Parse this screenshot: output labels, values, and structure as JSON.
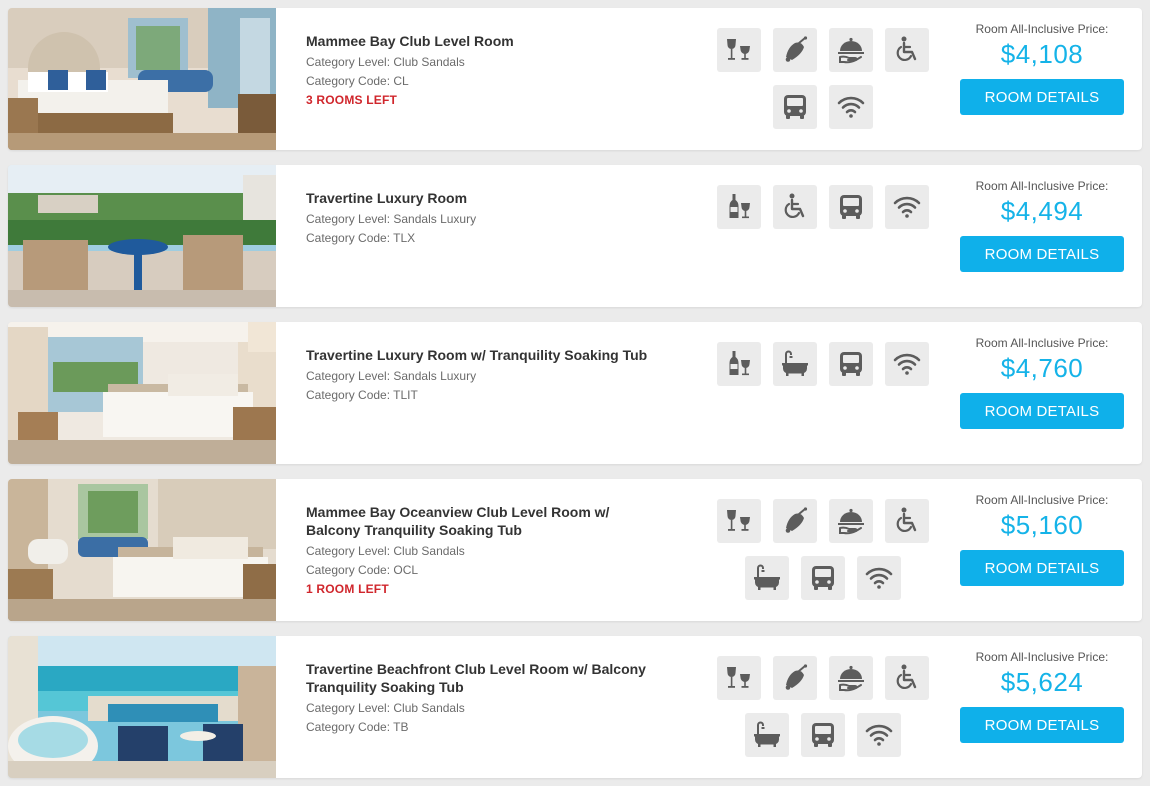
{
  "price_label": "Room All-Inclusive Price:",
  "button_label": "ROOM DETAILS",
  "colors": {
    "accent": "#0fb0ea",
    "alert": "#d0262c",
    "icon": "#5c5c5c",
    "icon_bg": "#ebebeb"
  },
  "rooms": [
    {
      "name": "Mammee Bay Club Level Room",
      "category_level": "Category Level: Club Sandals",
      "category_code": "Category Code: CL",
      "rooms_left": "3 ROOMS LEFT",
      "price": "$4,108",
      "amenities": [
        [
          "wine-glasses-icon",
          "bell-icon",
          "room-service-icon",
          "accessible-icon"
        ],
        [
          "shuttle-bus-icon",
          "wifi-icon"
        ]
      ]
    },
    {
      "name": "Travertine Luxury Room",
      "category_level": "Category Level: Sandals Luxury",
      "category_code": "Category Code: TLX",
      "rooms_left": "",
      "price": "$4,494",
      "amenities": [
        [
          "wine-bottle-icon",
          "accessible-icon",
          "shuttle-bus-icon",
          "wifi-icon"
        ]
      ]
    },
    {
      "name": "Travertine Luxury Room w/ Tranquility Soaking Tub",
      "category_level": "Category Level: Sandals Luxury",
      "category_code": "Category Code: TLIT",
      "rooms_left": "",
      "price": "$4,760",
      "amenities": [
        [
          "wine-bottle-icon",
          "bathtub-icon",
          "shuttle-bus-icon",
          "wifi-icon"
        ]
      ]
    },
    {
      "name": "Mammee Bay Oceanview Club Level Room w/ Balcony Tranquility Soaking Tub",
      "category_level": "Category Level: Club Sandals",
      "category_code": "Category Code: OCL",
      "rooms_left": "1 ROOM LEFT",
      "price": "$5,160",
      "amenities": [
        [
          "wine-glasses-icon",
          "bell-icon",
          "room-service-icon",
          "accessible-icon"
        ],
        [
          "bathtub-icon",
          "shuttle-bus-icon",
          "wifi-icon"
        ]
      ]
    },
    {
      "name": "Travertine Beachfront Club Level Room w/ Balcony Tranquility Soaking Tub",
      "category_level": "Category Level: Club Sandals",
      "category_code": "Category Code: TB",
      "rooms_left": "",
      "price": "$5,624",
      "amenities": [
        [
          "wine-glasses-icon",
          "bell-icon",
          "room-service-icon",
          "accessible-icon"
        ],
        [
          "bathtub-icon",
          "shuttle-bus-icon",
          "wifi-icon"
        ]
      ]
    }
  ]
}
